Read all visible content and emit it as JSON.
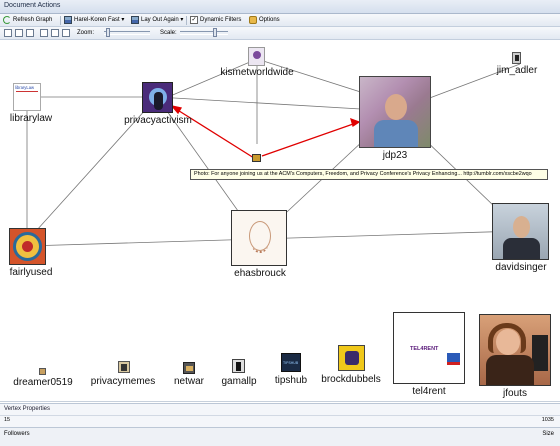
{
  "window": {
    "title": "Document Actions"
  },
  "toolbar": {
    "refresh_label": "Refresh Graph",
    "layout_algo": "Harel-Koren Fast",
    "layout_again_label": "Lay Out Again",
    "dynamic_filters_label": "Dynamic Filters",
    "options_label": "Options"
  },
  "toolbar2": {
    "zoom_label": "Zoom:",
    "scale_label": "Scale:"
  },
  "graph": {
    "vertices": {
      "kismetworldwide": "kismetworldwide",
      "jim_adler": "jim_adler",
      "librarylaw": "librarylaw",
      "privacyactivism": "privacyactivism",
      "jdp23": "jdp23",
      "fairlyused": "fairlyused",
      "ehasbrouck": "ehasbrouck",
      "davidsinger": "davidsinger",
      "dreamer0519": "dreamer0519",
      "privacymemes": "privacymemes",
      "netwar": "netwar",
      "gamallp": "gamallp",
      "tipshub": "tipshub",
      "brockdubbels": "brockdubbels",
      "tel4rent": "tel4rent",
      "jfouts": "jfouts"
    },
    "image_text": {
      "librarylaw": "libraryLaw",
      "tel4rent": "TEL4RENT",
      "tipshub": "TIPSHUB"
    },
    "tooltip": "Photo: For anyone joining us at the ACM's Computers, Freedom, and Privacy Conference's Privacy Enhancing... http://tumblr.com/xscbe2wqo",
    "edge_color": "#777777",
    "highlight_edge_color": "#e00000"
  },
  "vertex_properties": {
    "title": "Vertex Properties",
    "left_value": "15",
    "right_value": "1035"
  },
  "followers": {
    "label": "Followers",
    "size_label": "Size"
  }
}
